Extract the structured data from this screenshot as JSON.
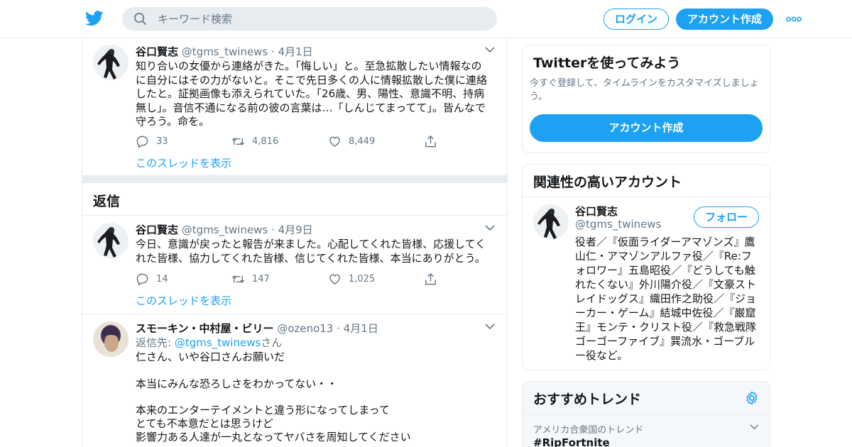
{
  "header": {
    "search_placeholder": "キーワード検索",
    "login_label": "ログイン",
    "signup_label": "アカウント作成"
  },
  "tweets": [
    {
      "name": "谷口賢志",
      "handle": "@tgms_twinews",
      "date": "4月1日",
      "text": "知り合いの女優から連絡がきた。「悔しい」と。至急拡散したい情報なのに自分にはその力がないと。そこで先日多くの人に情報拡散した僕に連絡したと。証拠画像も添えられていた。「26歳、男、陽性、意識不明、持病無し」。音信不通になる前の彼の言葉は…「しんじてまってて」。皆んなで守ろう。命を。",
      "replies": "33",
      "retweets": "4,816",
      "likes": "8,449",
      "show_thread": "このスレッドを表示"
    },
    {
      "name": "谷口賢志",
      "handle": "@tgms_twinews",
      "date": "4月9日",
      "text": "今日、意識が戻ったと報告が来ました。心配してくれた皆様、応援してくれた皆様、協力してくれた皆様、信じてくれた皆様、本当にありがとう。",
      "replies": "14",
      "retweets": "147",
      "likes": "1,025",
      "show_thread": "このスレッドを表示"
    },
    {
      "name": "スモーキン・中村屋・ビリー",
      "handle": "@ozeno13",
      "date": "4月1日",
      "reply_prefix": "返信先: ",
      "reply_to": "@tgms_twinews",
      "reply_suffix": "さん",
      "text": "仁さん、いや谷口さんお願いだ\n\n本当にみんな恐ろしさをわかってない・・\n\n本来のエンターテイメントと違う形になってしまって\nとても不本意だとは思うけど\n影響力ある人達が一丸となってヤバさを周知してください"
    }
  ],
  "replies_section_title": "返信",
  "sidebar": {
    "signup_card": {
      "title": "Twitterを使ってみよう",
      "subtitle": "今すぐ登録して、タイムラインをカスタマイズしましょう。",
      "button": "アカウント作成"
    },
    "related_card": {
      "title": "関連性の高いアカウント",
      "name": "谷口賢志",
      "handle": "@tgms_twinews",
      "follow_label": "フォロー",
      "bio": "役者／『仮面ライダーアマゾンズ』鷹山仁・アマゾンアルファ役／『Re:フォロワー』五島昭役／『どうしても触れたくない』外川陽介役／『文豪ストレイドッグス』織田作之助役／『ジョーカー・ゲーム』結城中佐役／『巌窟王』モンテ・クリスト役／『救急戦隊ゴーゴーファイブ』巽流水・ゴーブルー役など。"
    },
    "trends_card": {
      "title": "おすすめトレンド",
      "location": "アメリカ合衆国のトレンド",
      "trend1": "#RipFortnite"
    }
  },
  "colors": {
    "accent": "#1da1f2",
    "muted": "#657786",
    "border": "#e6ecf0"
  }
}
